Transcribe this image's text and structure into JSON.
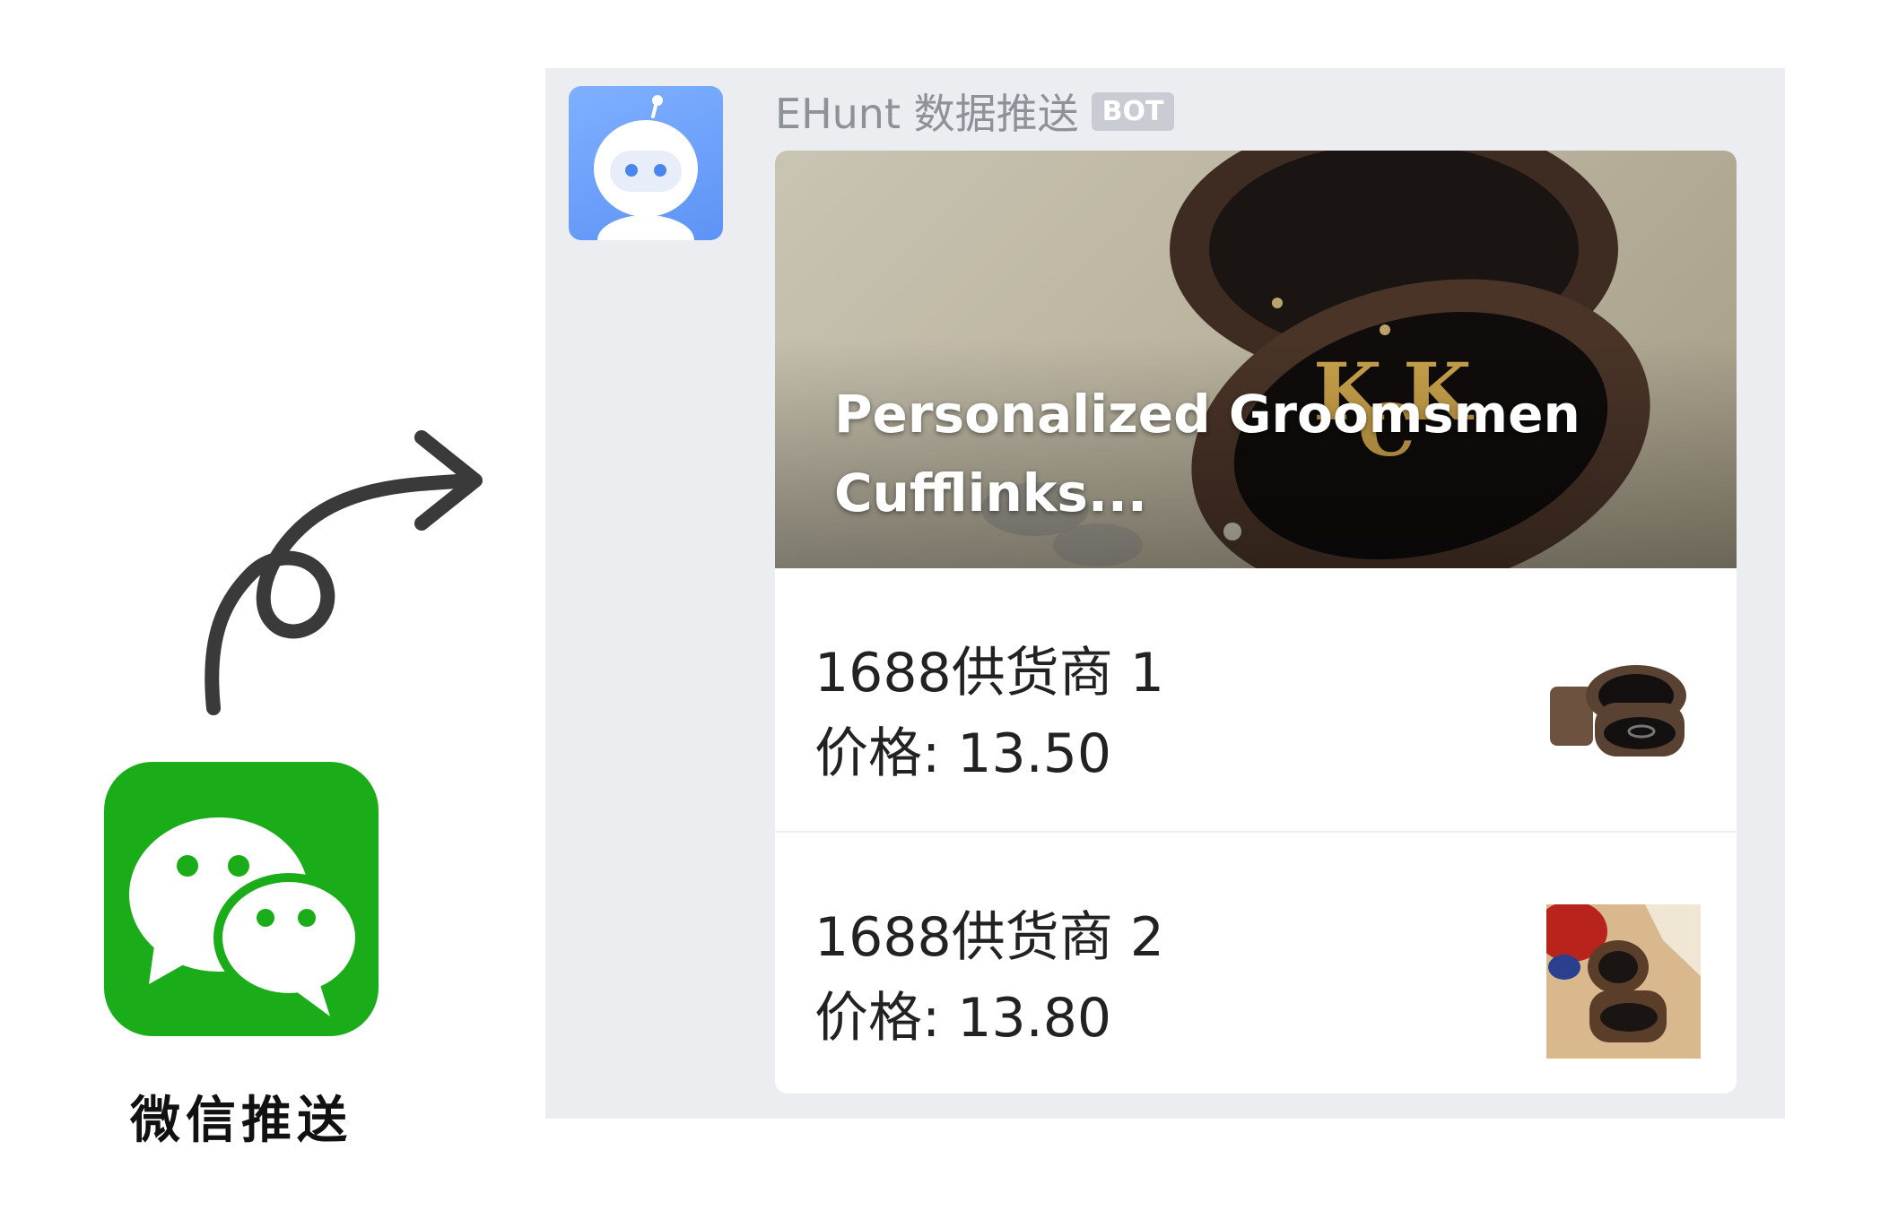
{
  "chat": {
    "sender_name": "EHunt 数据推送",
    "sender_badge": "BOT"
  },
  "card": {
    "cover_title_line1": "Personalized Groomsmen",
    "cover_title_line2": "Cufflinks...",
    "items": [
      {
        "supplier": "1688供货商 1",
        "price": "价格: 13.50"
      },
      {
        "supplier": "1688供货商 2",
        "price": "价格: 13.80"
      }
    ]
  },
  "app": {
    "caption": "微信推送",
    "icon": "wechat-icon",
    "brand_color": "#1aad19"
  },
  "colors": {
    "panel_bg": "#ebedf1",
    "avatar_blue": "#6a9ef8",
    "sender_gray": "#8d9198"
  }
}
